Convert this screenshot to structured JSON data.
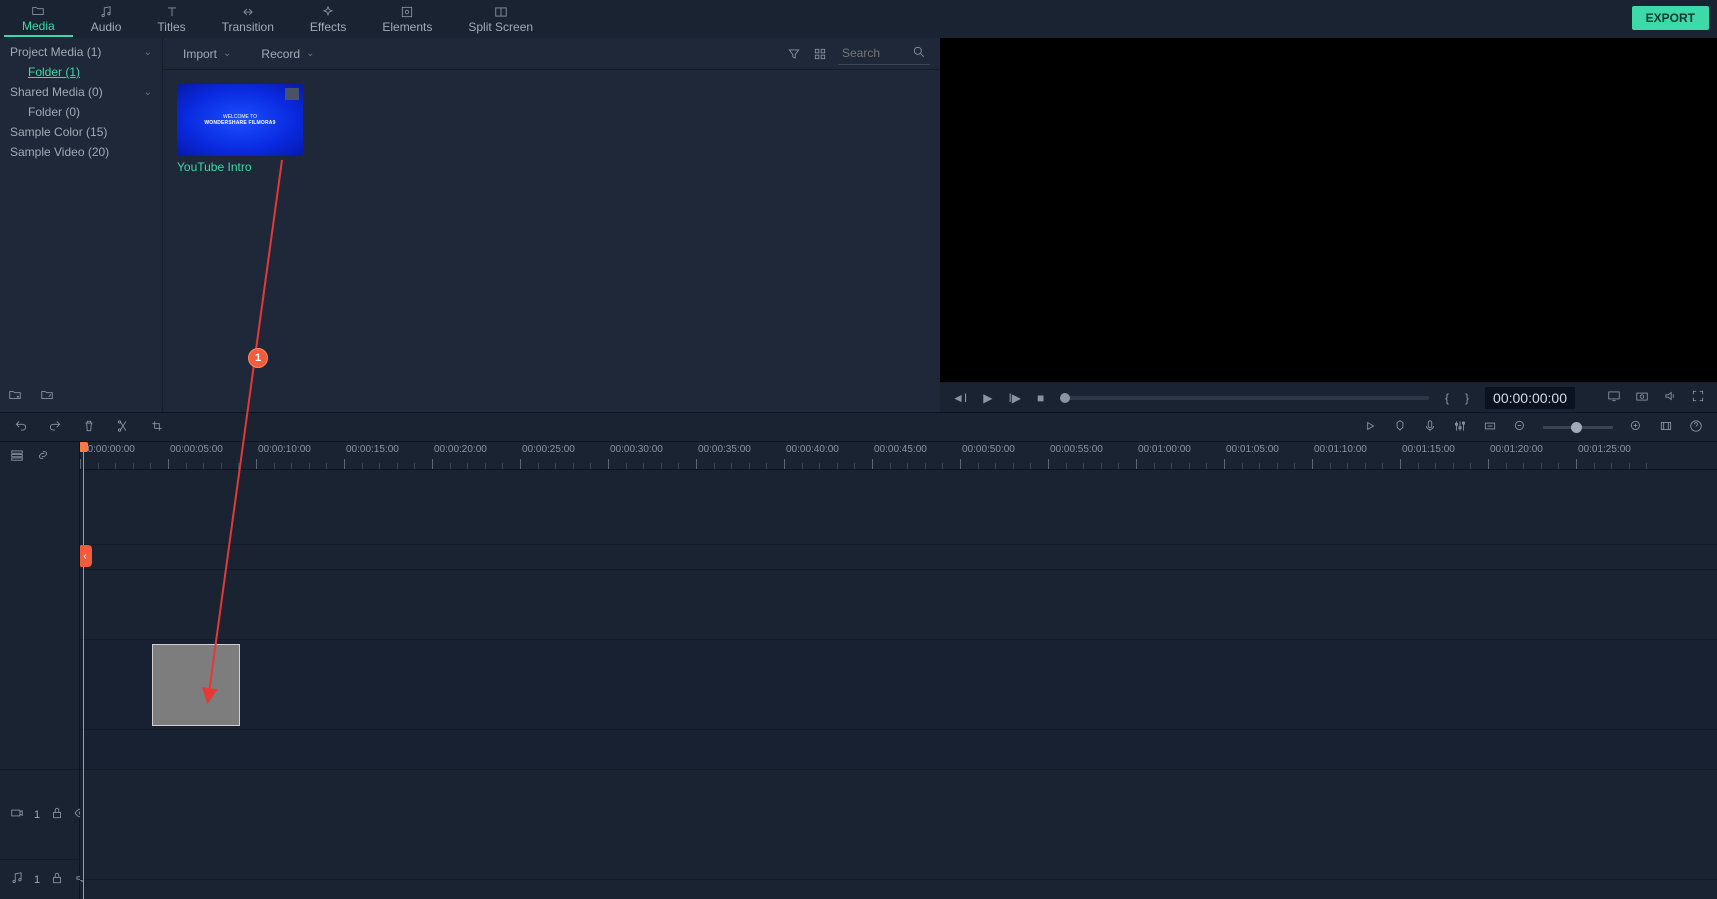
{
  "tabs": {
    "media": "Media",
    "audio": "Audio",
    "titles": "Titles",
    "transition": "Transition",
    "effects": "Effects",
    "elements": "Elements",
    "splitscreen": "Split Screen"
  },
  "export_btn": "EXPORT",
  "sidebar": {
    "project_media": "Project Media (1)",
    "folder1": "Folder (1)",
    "shared_media": "Shared Media (0)",
    "folder0": "Folder (0)",
    "sample_color": "Sample Color (15)",
    "sample_video": "Sample Video (20)"
  },
  "media_toolbar": {
    "import": "Import",
    "record": "Record",
    "search_placeholder": "Search"
  },
  "media_items": [
    {
      "name": "YouTube Intro",
      "thumb_line1": "WELCOME TO",
      "thumb_line2": "WONDERSHARE FILMORA9"
    }
  ],
  "preview": {
    "timecode": "00:00:00:00",
    "markers_left": "{",
    "markers_right": "}"
  },
  "timeline": {
    "ruler": [
      "00:00:00:00",
      "00:00:05:00",
      "00:00:10:00",
      "00:00:15:00",
      "00:00:20:00",
      "00:00:25:00",
      "00:00:30:00",
      "00:00:35:00",
      "00:00:40:00",
      "00:00:45:00",
      "00:00:50:00",
      "00:00:55:00",
      "00:01:00:00",
      "00:01:05:00",
      "00:01:10:00",
      "00:01:15:00",
      "00:01:20:00",
      "00:01:25:00"
    ],
    "video_track_label": "1",
    "audio_track_label": "1"
  },
  "annotation": {
    "badge": "1"
  }
}
